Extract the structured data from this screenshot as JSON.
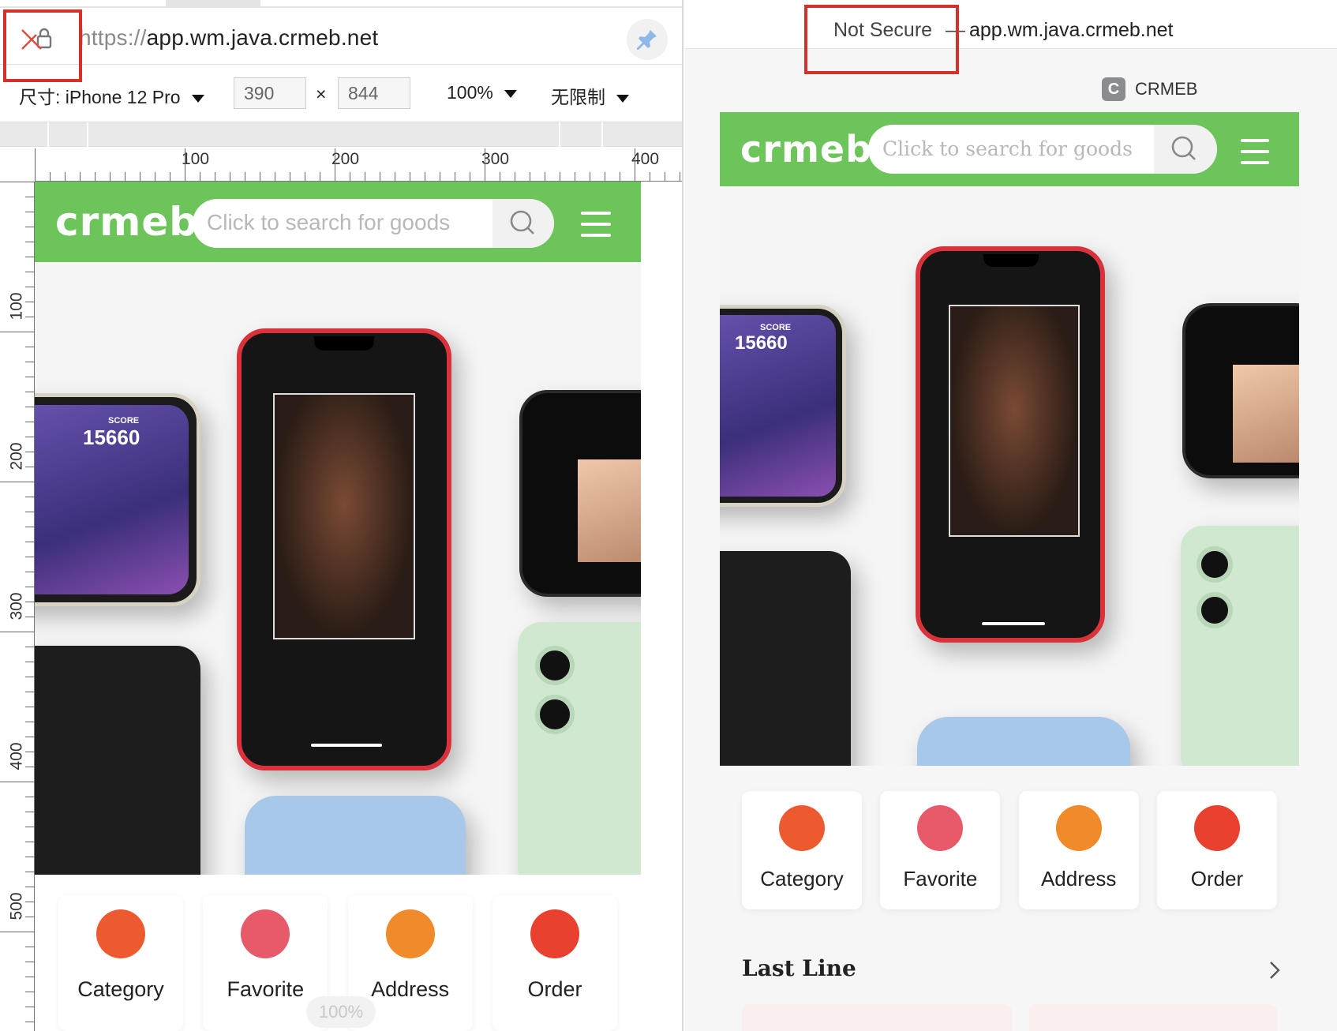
{
  "left_pane": {
    "address_bar": {
      "scheme": "https://",
      "host": "app.wm.java.crmeb.net"
    },
    "device_toolbar": {
      "size_label": "尺寸: iPhone 12 Pro",
      "width": "390",
      "times": "×",
      "height": "844",
      "zoom": "100%",
      "throttle": "无限制"
    },
    "ruler_h": [
      "100",
      "200",
      "300",
      "400"
    ],
    "ruler_v": [
      "100",
      "200",
      "300",
      "400",
      "500"
    ],
    "zoom_indicator": "100%"
  },
  "right_pane": {
    "address_bar": {
      "security": "Not Secure",
      "separator": "—",
      "host": "app.wm.java.crmeb.net"
    },
    "tab": {
      "favicon_letter": "C",
      "title": "CRMEB"
    },
    "section_title": "Last Line"
  },
  "app": {
    "logo": "crmeb",
    "search_placeholder": "Click to search for goods",
    "banner_score_label": "SCORE",
    "banner_score": "15660",
    "categories": [
      {
        "label": "Category",
        "icon": "list-icon",
        "color": "#ee5a2f"
      },
      {
        "label": "Favorite",
        "icon": "gift-box-icon",
        "color": "#e85a6a"
      },
      {
        "label": "Address",
        "icon": "photo-card-icon",
        "color": "#f08a2a"
      },
      {
        "label": "Order",
        "icon": "ticket-icon",
        "color": "#e8412f"
      }
    ]
  },
  "colors": {
    "brand_green": "#6cc45a",
    "highlight_red": "#d3322b"
  }
}
